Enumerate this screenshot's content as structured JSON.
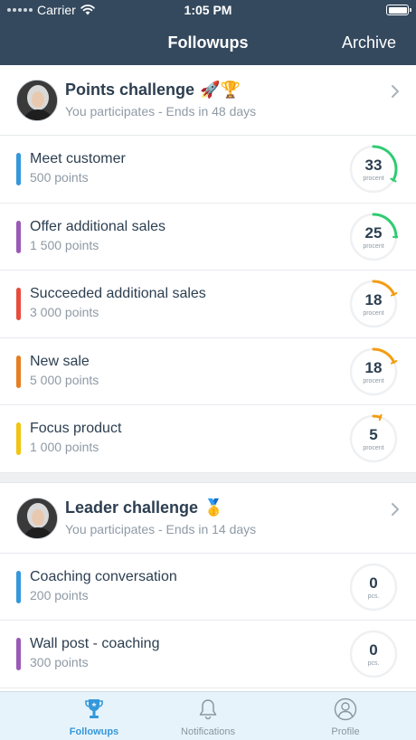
{
  "status_bar": {
    "carrier": "Carrier",
    "time": "1:05 PM"
  },
  "nav": {
    "title": "Followups",
    "archive_label": "Archive"
  },
  "challenges": [
    {
      "title": "Points challenge",
      "emoji": "🚀🏆",
      "subtitle": "You participates - Ends in 48 days",
      "items": [
        {
          "title": "Meet customer",
          "points": "500 points",
          "value": "33",
          "unit": "procent",
          "percent": 33,
          "color": "#3498db",
          "ring_color": "#2ecc71"
        },
        {
          "title": "Offer additional sales",
          "points": "1 500 points",
          "value": "25",
          "unit": "procent",
          "percent": 25,
          "color": "#9b59b6",
          "ring_color": "#2ecc71"
        },
        {
          "title": "Succeeded additional sales",
          "points": "3 000 points",
          "value": "18",
          "unit": "procent",
          "percent": 18,
          "color": "#e74c3c",
          "ring_color": "#f39c12"
        },
        {
          "title": "New sale",
          "points": "5 000 points",
          "value": "18",
          "unit": "procent",
          "percent": 18,
          "color": "#e67e22",
          "ring_color": "#f39c12"
        },
        {
          "title": "Focus product",
          "points": "1 000 points",
          "value": "5",
          "unit": "procent",
          "percent": 5,
          "color": "#f1c40f",
          "ring_color": "#f39c12"
        }
      ]
    },
    {
      "title": "Leader challenge",
      "emoji": "🥇",
      "subtitle": "You participates - Ends in 14 days",
      "items": [
        {
          "title": "Coaching conversation",
          "points": "200 points",
          "value": "0",
          "unit": "pcs.",
          "percent": 0,
          "color": "#3498db",
          "ring_color": "#2ecc71"
        },
        {
          "title": "Wall post - coaching",
          "points": "300 points",
          "value": "0",
          "unit": "pcs.",
          "percent": 0,
          "color": "#9b59b6",
          "ring_color": "#2ecc71"
        }
      ]
    }
  ],
  "tabs": [
    {
      "label": "Followups",
      "icon": "trophy-icon",
      "active": true
    },
    {
      "label": "Notifications",
      "icon": "bell-icon",
      "active": false
    },
    {
      "label": "Profile",
      "icon": "user-icon",
      "active": false
    }
  ],
  "colors": {
    "nav_bg": "#34495e",
    "active_tab": "#3498db",
    "tab_bg": "#e6f3fa"
  }
}
